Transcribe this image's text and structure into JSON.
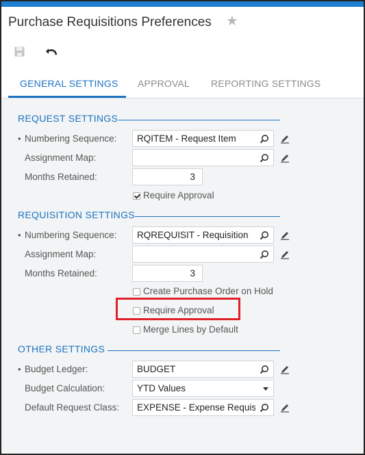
{
  "header": {
    "title": "Purchase Requisitions Preferences"
  },
  "toolbar": {
    "save": "save-icon",
    "undo": "undo-icon"
  },
  "tabs": [
    {
      "label": "GENERAL SETTINGS",
      "active": true
    },
    {
      "label": "APPROVAL",
      "active": false
    },
    {
      "label": "REPORTING SETTINGS",
      "active": false
    }
  ],
  "request_settings": {
    "heading": "REQUEST SETTINGS",
    "numbering_label": "Numbering Sequence:",
    "numbering_value": "RQITEM - Request Item",
    "assignment_label": "Assignment Map:",
    "assignment_value": "",
    "months_label": "Months Retained:",
    "months_value": "3",
    "require_approval_label": "Require Approval",
    "require_approval_checked": true
  },
  "requisition_settings": {
    "heading": "REQUISITION SETTINGS",
    "numbering_label": "Numbering Sequence:",
    "numbering_value": "RQREQUISIT - Requisition",
    "assignment_label": "Assignment Map:",
    "assignment_value": "",
    "months_label": "Months Retained:",
    "months_value": "3",
    "create_po_hold_label": "Create Purchase Order on Hold",
    "create_po_hold_checked": false,
    "require_approval_label": "Require Approval",
    "require_approval_checked": false,
    "merge_lines_label": "Merge Lines by Default",
    "merge_lines_checked": false
  },
  "other_settings": {
    "heading": "OTHER SETTINGS",
    "budget_ledger_label": "Budget Ledger:",
    "budget_ledger_value": "BUDGET",
    "budget_calc_label": "Budget Calculation:",
    "budget_calc_value": "YTD Values",
    "default_class_label": "Default Request Class:",
    "default_class_value": "EXPENSE - Expense Requisition"
  },
  "required_marker": "•",
  "colors": {
    "accent": "#1c73c1",
    "top_bar": "#1f7fd1",
    "highlight": "#e0202a",
    "content_bg": "#f2f4f5"
  }
}
